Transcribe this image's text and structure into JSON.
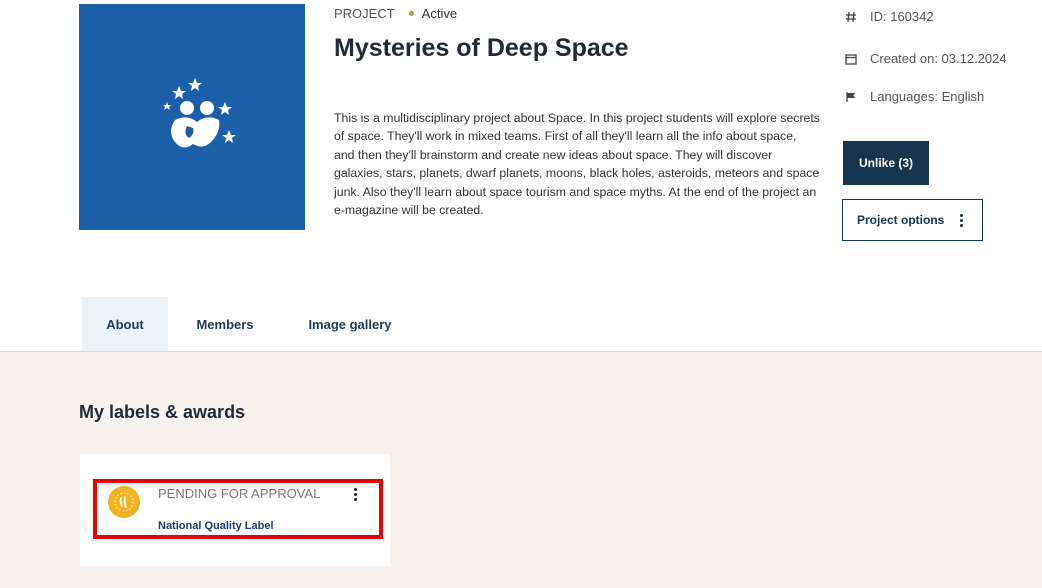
{
  "header": {
    "type_label": "PROJECT",
    "status": "Active",
    "title": "Mysteries of Deep Space",
    "description": "This is a multidisciplinary project about Space. In this project students will explore secrets of space. They'll work in mixed teams. First of all they'll learn all the info about space, and then they'll brainstorm and create new ideas about space. They will discover galaxies, stars, planets, dwarf planets, moons, black holes, asteroids, meteors and space junk. Also they'll learn about space tourism and space myths. At the end of the project an e-magazine will be created."
  },
  "info": {
    "id": "ID: 160342",
    "created": "Created on: 03.12.2024",
    "languages": "Languages: English"
  },
  "actions": {
    "unlike": "Unlike (3)",
    "options": "Project options"
  },
  "tabs": [
    {
      "label": "About"
    },
    {
      "label": "Members"
    },
    {
      "label": "Image gallery"
    }
  ],
  "labels": {
    "section_title": "My labels & awards",
    "items": [
      {
        "status": "PENDING FOR APPROVAL",
        "name": "National Quality Label"
      }
    ]
  },
  "colors": {
    "primary": "#16344d",
    "project_image": "#1a5fa8",
    "status_active": "#8ab33a",
    "section_bg": "#f7f2ed",
    "highlight": "#ee0000",
    "badge": "#f0b324"
  },
  "icons": {
    "id": "hash-icon",
    "created": "calendar-icon",
    "languages": "flag-icon",
    "options": "kebab-menu-icon"
  }
}
